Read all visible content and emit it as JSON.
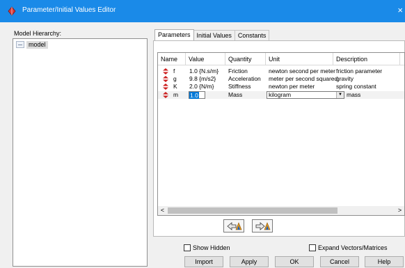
{
  "window": {
    "title": "Parameter/Initial Values Editor",
    "close_glyph": "×"
  },
  "hierarchy": {
    "label": "Model Hierarchy:",
    "items": [
      {
        "label": "model"
      }
    ]
  },
  "tabs": [
    {
      "label": "Parameters",
      "active": true
    },
    {
      "label": "Initial Values",
      "active": false
    },
    {
      "label": "Constants",
      "active": false
    }
  ],
  "table": {
    "columns": [
      "Name",
      "Value",
      "Quantity",
      "Unit",
      "Description"
    ],
    "rows": [
      {
        "name": "f",
        "value": "1.0 {N.s/m}",
        "quantity": "Friction",
        "unit": "newton second per meter",
        "description": "friction parameter"
      },
      {
        "name": "g",
        "value": "9.8 {m/s2}",
        "quantity": "Acceleration",
        "unit": "meter per second squared",
        "description": "gravity"
      },
      {
        "name": "K",
        "value": "2.0 {N/m}",
        "quantity": "Stiffness",
        "unit": "newton per meter",
        "description": "spring constant"
      },
      {
        "name": "m",
        "value": "1.0",
        "quantity": "Mass",
        "unit": "kilogram",
        "description": "mass"
      }
    ],
    "editing_row": 3,
    "scroll_left": "<",
    "scroll_right": ">"
  },
  "options": {
    "show_hidden": "Show Hidden",
    "expand_vectors": "Expand Vectors/Matrices"
  },
  "buttons": {
    "import": "Import",
    "apply": "Apply",
    "ok": "OK",
    "cancel": "Cancel",
    "help": "Help"
  },
  "colors": {
    "titlebar": "#1a8ae8",
    "param_icon": "#cc1f1f",
    "selection": "#0078d7"
  }
}
